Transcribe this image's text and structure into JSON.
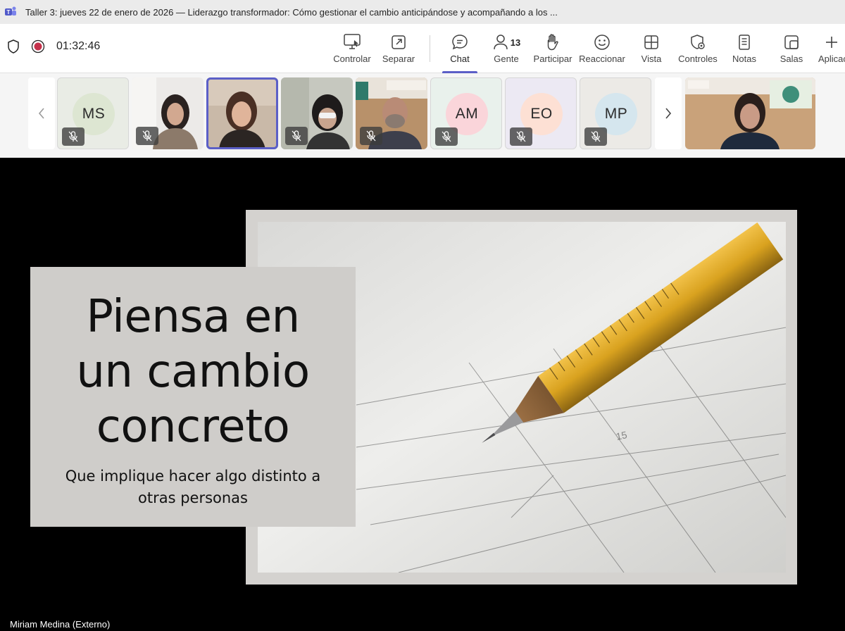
{
  "window": {
    "title": "Taller 3: jueves 22 de enero de 2026 — Liderazgo transformador: Cómo gestionar el cambio anticipándose y acompañando a los ..."
  },
  "meeting": {
    "timer": "01:32:46",
    "people_count": "13"
  },
  "toolbar": {
    "controlar": "Controlar",
    "separar": "Separar",
    "chat": "Chat",
    "gente": "Gente",
    "participar": "Participar",
    "reaccionar": "Reaccionar",
    "vista": "Vista",
    "controles": "Controles",
    "notas": "Notas",
    "salas": "Salas",
    "aplicaciones": "Aplicac"
  },
  "participants": [
    {
      "initials": "MS",
      "color": "#e6ecdd"
    },
    {
      "initials": "AM",
      "color": "#fad5da"
    },
    {
      "initials": "EO",
      "color": "#fde0d4"
    },
    {
      "initials": "MP",
      "color": "#d5e6ee"
    }
  ],
  "slide": {
    "title_line1": "Piensa en",
    "title_line2": "un cambio",
    "title_line3": "concreto",
    "subtitle_line1": "Que implique hacer algo distinto a",
    "subtitle_line2": "otras personas"
  },
  "speaker": {
    "name": "Miriam Medina (Externo)"
  },
  "colors": {
    "accent": "#5b5fc7",
    "record": "#c4314b"
  }
}
